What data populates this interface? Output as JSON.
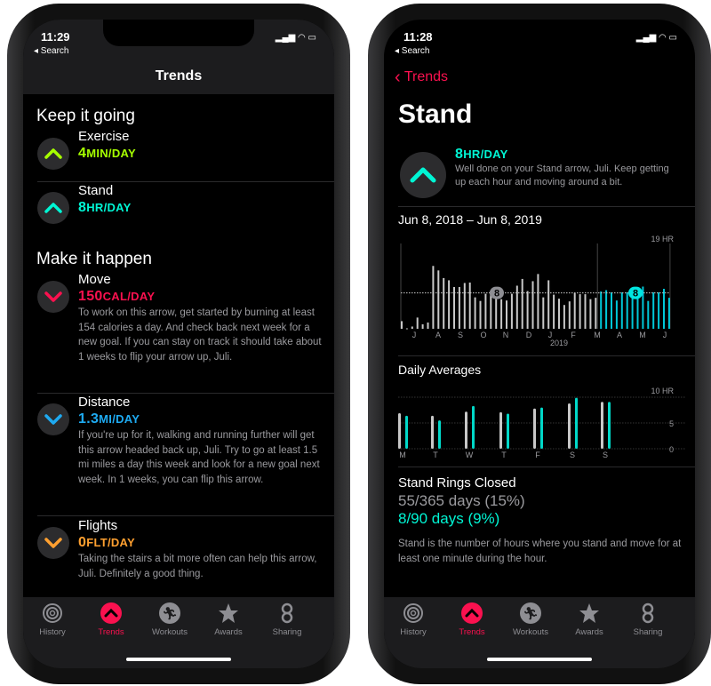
{
  "colors": {
    "move": "#fa114f",
    "exercise": "#a6ff00",
    "stand": "#00f5d4",
    "distance": "#1eaaf1",
    "flights": "#ffa030",
    "tint": "#fa114f"
  },
  "left": {
    "status": {
      "time": "11:29",
      "back": "◂ Search"
    },
    "title": "Trends",
    "section1": "Keep it going",
    "section2": "Make it happen",
    "items": [
      {
        "icon": "arrow-up-icon",
        "label": "Exercise",
        "value": "4",
        "unit": "MIN/DAY",
        "desc": ""
      },
      {
        "icon": "arrow-up-icon",
        "label": "Stand",
        "value": "8",
        "unit": "HR/DAY",
        "desc": ""
      },
      {
        "icon": "arrow-down-icon",
        "label": "Move",
        "value": "150",
        "unit": "CAL/DAY",
        "desc": "To work on this arrow, get started by burning at least 154 calories a day. And check back next week for a new goal. If you can stay on track it should take about 1 weeks to flip your arrow up, Juli."
      },
      {
        "icon": "arrow-down-icon",
        "label": "Distance",
        "value": "1.3",
        "unit": "MI/DAY",
        "desc": "If you're up for it, walking and running further will get this arrow headed back up, Juli. Try to go at least 1.5 mi miles a day this week and look for a new goal next week. In 1 weeks, you can flip this arrow."
      },
      {
        "icon": "arrow-down-icon",
        "label": "Flights",
        "value": "0",
        "unit": "FLT/DAY",
        "desc": "Taking the stairs a bit more often can help this arrow, Juli. Definitely a good thing."
      }
    ]
  },
  "right": {
    "status": {
      "time": "11:28",
      "back": "◂ Search"
    },
    "back_label": "Trends",
    "title": "Stand",
    "value": "8",
    "unit": "HR/DAY",
    "desc": "Well done on your Stand arrow, Juli. Keep getting up each hour and moving around a bit.",
    "range": "Jun 8, 2018 – Jun 8, 2019",
    "daily_title": "Daily Averages",
    "rings_title": "Stand Rings Closed",
    "rings_year": "55/365 days (15%)",
    "rings_90": "8/90 days (9%)",
    "footer": "Stand is the number of hours where you stand and move for at least one minute during the hour."
  },
  "tabs": [
    {
      "label": "History",
      "icon": "history-rings-icon"
    },
    {
      "label": "Trends",
      "icon": "trends-icon",
      "active": true
    },
    {
      "label": "Workouts",
      "icon": "workouts-runner-icon"
    },
    {
      "label": "Awards",
      "icon": "awards-star-icon"
    },
    {
      "label": "Sharing",
      "icon": "sharing-icon"
    }
  ],
  "chart_data": [
    {
      "type": "bar",
      "ylabel_top": "19 HR",
      "ylim": [
        0,
        19
      ],
      "average_label": "8",
      "average": 8,
      "recent_average_label": "8",
      "recent_average": 8,
      "month_labels": [
        "J",
        "A",
        "S",
        "O",
        "N",
        "D",
        "J",
        "F",
        "M",
        "A",
        "M",
        "J"
      ],
      "year_label": "2019",
      "values": [
        1.7,
        0.1,
        0.5,
        2.5,
        1,
        1.4,
        14,
        13,
        11.3,
        10.8,
        9.3,
        9.3,
        10.2,
        10.3,
        7,
        6.2,
        7.8,
        8.5,
        7.4,
        6.6,
        6.3,
        7.8,
        9.6,
        11.1,
        8.4,
        10.6,
        12.2,
        7,
        10.8,
        7.6,
        6.7,
        5.3,
        6.1,
        8,
        7.7,
        7.7,
        6.6,
        6.9,
        8.3,
        8.6,
        8.1,
        6.3,
        8.1,
        8.1,
        8.9,
        9.3,
        9.4,
        6.2,
        8.1,
        8.1,
        8.9,
        6.9
      ],
      "highlight_last_n": 14
    },
    {
      "type": "bar",
      "ylim": [
        0,
        10
      ],
      "tick_labels": [
        "10 HR",
        "5",
        "0"
      ],
      "categories": [
        "M",
        "T",
        "W",
        "T",
        "F",
        "S",
        "S"
      ],
      "series": [
        {
          "values": [
            6.9,
            6.4,
            7.2,
            7.1,
            7.8,
            8.8,
            9.1
          ]
        },
        {
          "values": [
            6.4,
            5.5,
            8.3,
            6.8,
            8.0,
            9.9,
            9.1
          ]
        }
      ]
    }
  ]
}
